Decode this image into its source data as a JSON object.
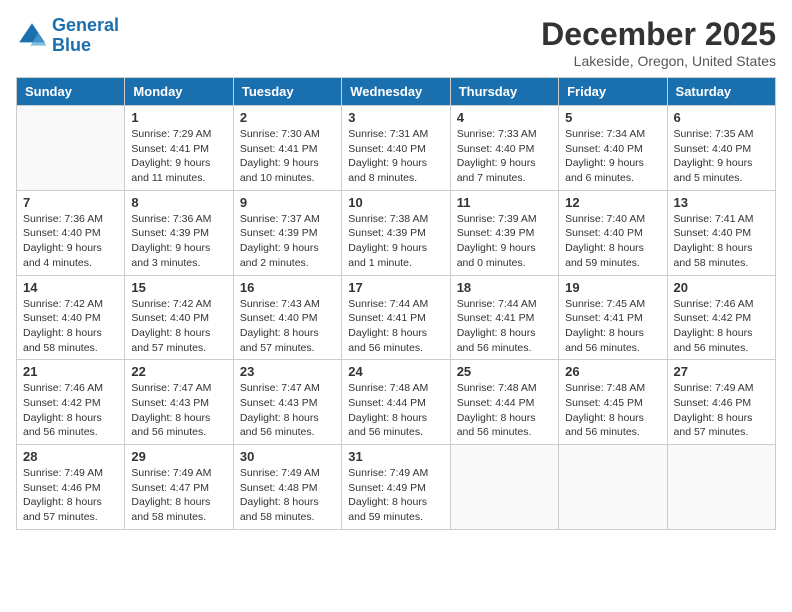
{
  "header": {
    "logo_line1": "General",
    "logo_line2": "Blue",
    "month_title": "December 2025",
    "location": "Lakeside, Oregon, United States"
  },
  "weekdays": [
    "Sunday",
    "Monday",
    "Tuesday",
    "Wednesday",
    "Thursday",
    "Friday",
    "Saturday"
  ],
  "weeks": [
    [
      {
        "day": "",
        "info": ""
      },
      {
        "day": "1",
        "info": "Sunrise: 7:29 AM\nSunset: 4:41 PM\nDaylight: 9 hours\nand 11 minutes."
      },
      {
        "day": "2",
        "info": "Sunrise: 7:30 AM\nSunset: 4:41 PM\nDaylight: 9 hours\nand 10 minutes."
      },
      {
        "day": "3",
        "info": "Sunrise: 7:31 AM\nSunset: 4:40 PM\nDaylight: 9 hours\nand 8 minutes."
      },
      {
        "day": "4",
        "info": "Sunrise: 7:33 AM\nSunset: 4:40 PM\nDaylight: 9 hours\nand 7 minutes."
      },
      {
        "day": "5",
        "info": "Sunrise: 7:34 AM\nSunset: 4:40 PM\nDaylight: 9 hours\nand 6 minutes."
      },
      {
        "day": "6",
        "info": "Sunrise: 7:35 AM\nSunset: 4:40 PM\nDaylight: 9 hours\nand 5 minutes."
      }
    ],
    [
      {
        "day": "7",
        "info": "Sunrise: 7:36 AM\nSunset: 4:40 PM\nDaylight: 9 hours\nand 4 minutes."
      },
      {
        "day": "8",
        "info": "Sunrise: 7:36 AM\nSunset: 4:39 PM\nDaylight: 9 hours\nand 3 minutes."
      },
      {
        "day": "9",
        "info": "Sunrise: 7:37 AM\nSunset: 4:39 PM\nDaylight: 9 hours\nand 2 minutes."
      },
      {
        "day": "10",
        "info": "Sunrise: 7:38 AM\nSunset: 4:39 PM\nDaylight: 9 hours\nand 1 minute."
      },
      {
        "day": "11",
        "info": "Sunrise: 7:39 AM\nSunset: 4:39 PM\nDaylight: 9 hours\nand 0 minutes."
      },
      {
        "day": "12",
        "info": "Sunrise: 7:40 AM\nSunset: 4:40 PM\nDaylight: 8 hours\nand 59 minutes."
      },
      {
        "day": "13",
        "info": "Sunrise: 7:41 AM\nSunset: 4:40 PM\nDaylight: 8 hours\nand 58 minutes."
      }
    ],
    [
      {
        "day": "14",
        "info": "Sunrise: 7:42 AM\nSunset: 4:40 PM\nDaylight: 8 hours\nand 58 minutes."
      },
      {
        "day": "15",
        "info": "Sunrise: 7:42 AM\nSunset: 4:40 PM\nDaylight: 8 hours\nand 57 minutes."
      },
      {
        "day": "16",
        "info": "Sunrise: 7:43 AM\nSunset: 4:40 PM\nDaylight: 8 hours\nand 57 minutes."
      },
      {
        "day": "17",
        "info": "Sunrise: 7:44 AM\nSunset: 4:41 PM\nDaylight: 8 hours\nand 56 minutes."
      },
      {
        "day": "18",
        "info": "Sunrise: 7:44 AM\nSunset: 4:41 PM\nDaylight: 8 hours\nand 56 minutes."
      },
      {
        "day": "19",
        "info": "Sunrise: 7:45 AM\nSunset: 4:41 PM\nDaylight: 8 hours\nand 56 minutes."
      },
      {
        "day": "20",
        "info": "Sunrise: 7:46 AM\nSunset: 4:42 PM\nDaylight: 8 hours\nand 56 minutes."
      }
    ],
    [
      {
        "day": "21",
        "info": "Sunrise: 7:46 AM\nSunset: 4:42 PM\nDaylight: 8 hours\nand 56 minutes."
      },
      {
        "day": "22",
        "info": "Sunrise: 7:47 AM\nSunset: 4:43 PM\nDaylight: 8 hours\nand 56 minutes."
      },
      {
        "day": "23",
        "info": "Sunrise: 7:47 AM\nSunset: 4:43 PM\nDaylight: 8 hours\nand 56 minutes."
      },
      {
        "day": "24",
        "info": "Sunrise: 7:48 AM\nSunset: 4:44 PM\nDaylight: 8 hours\nand 56 minutes."
      },
      {
        "day": "25",
        "info": "Sunrise: 7:48 AM\nSunset: 4:44 PM\nDaylight: 8 hours\nand 56 minutes."
      },
      {
        "day": "26",
        "info": "Sunrise: 7:48 AM\nSunset: 4:45 PM\nDaylight: 8 hours\nand 56 minutes."
      },
      {
        "day": "27",
        "info": "Sunrise: 7:49 AM\nSunset: 4:46 PM\nDaylight: 8 hours\nand 57 minutes."
      }
    ],
    [
      {
        "day": "28",
        "info": "Sunrise: 7:49 AM\nSunset: 4:46 PM\nDaylight: 8 hours\nand 57 minutes."
      },
      {
        "day": "29",
        "info": "Sunrise: 7:49 AM\nSunset: 4:47 PM\nDaylight: 8 hours\nand 58 minutes."
      },
      {
        "day": "30",
        "info": "Sunrise: 7:49 AM\nSunset: 4:48 PM\nDaylight: 8 hours\nand 58 minutes."
      },
      {
        "day": "31",
        "info": "Sunrise: 7:49 AM\nSunset: 4:49 PM\nDaylight: 8 hours\nand 59 minutes."
      },
      {
        "day": "",
        "info": ""
      },
      {
        "day": "",
        "info": ""
      },
      {
        "day": "",
        "info": ""
      }
    ]
  ]
}
